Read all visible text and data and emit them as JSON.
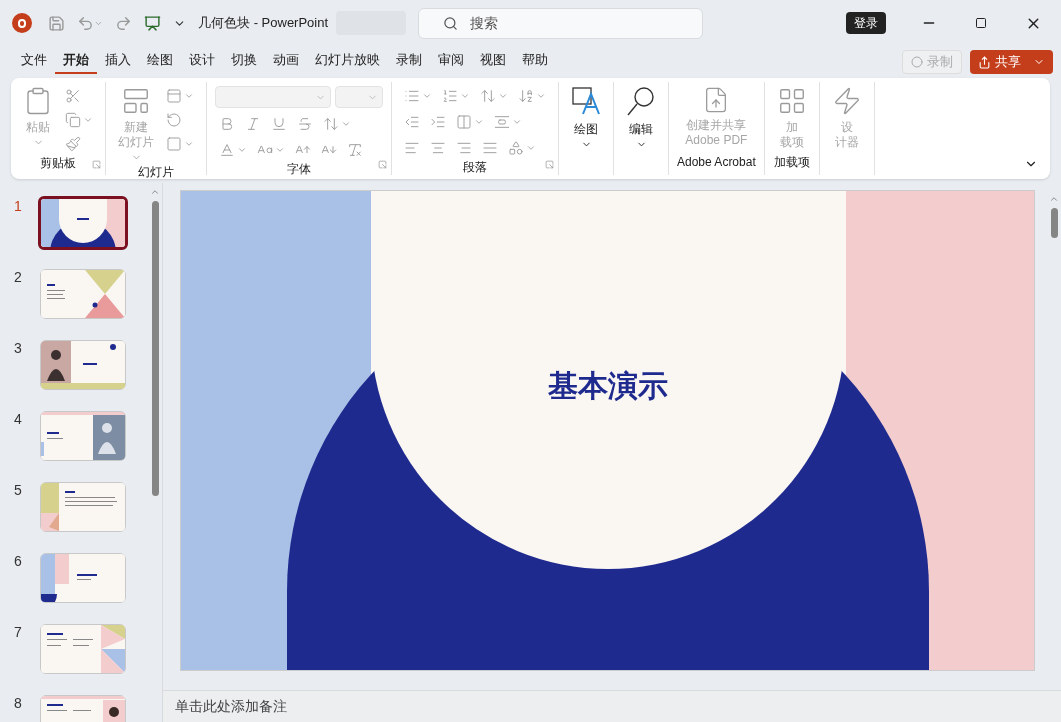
{
  "title_bar": {
    "doc_title": "几何色块",
    "separator": "-",
    "app_name": "PowerPoint",
    "search_placeholder": "搜索",
    "sign_in": "登录"
  },
  "menu_tabs": [
    {
      "label": "文件",
      "selected": false
    },
    {
      "label": "开始",
      "selected": true
    },
    {
      "label": "插入",
      "selected": false
    },
    {
      "label": "绘图",
      "selected": false
    },
    {
      "label": "设计",
      "selected": false
    },
    {
      "label": "切换",
      "selected": false
    },
    {
      "label": "动画",
      "selected": false
    },
    {
      "label": "幻灯片放映",
      "selected": false
    },
    {
      "label": "录制",
      "selected": false
    },
    {
      "label": "审阅",
      "selected": false
    },
    {
      "label": "视图",
      "selected": false
    },
    {
      "label": "帮助",
      "selected": false
    }
  ],
  "record_button": {
    "label": "录制",
    "disabled": true
  },
  "share_button": {
    "label": "共享"
  },
  "ribbon_groups": [
    {
      "kind": "clipboard",
      "label": "剪贴板",
      "launcher": true,
      "buttons": [
        {
          "lines": [
            "粘贴"
          ],
          "disabled": true,
          "dropdown": true
        }
      ]
    },
    {
      "kind": "slides",
      "label": "幻灯片",
      "buttons": [
        {
          "lines": [
            "新建",
            "幻灯片"
          ],
          "disabled": true,
          "dropdown": true
        }
      ]
    },
    {
      "kind": "font",
      "label": "字体",
      "launcher": true
    },
    {
      "kind": "paragraph",
      "label": "段落",
      "launcher": true
    },
    {
      "kind": "draw",
      "buttons": [
        {
          "lines": [
            "绘图"
          ],
          "disabled": false,
          "dropdown": true
        }
      ]
    },
    {
      "kind": "edit",
      "buttons": [
        {
          "lines": [
            "编辑"
          ],
          "disabled": false,
          "dropdown": true
        }
      ]
    },
    {
      "kind": "pdf",
      "label": "Adobe Acrobat",
      "buttons": [
        {
          "lines": [
            "创建并共享",
            "Adobe PDF"
          ],
          "disabled": true
        }
      ]
    },
    {
      "kind": "addins",
      "label": "加载项",
      "buttons": [
        {
          "lines": [
            "加",
            "载项"
          ],
          "disabled": true
        }
      ]
    },
    {
      "kind": "designer",
      "buttons": [
        {
          "lines": [
            "设",
            "计器"
          ],
          "disabled": true
        }
      ]
    }
  ],
  "slides": [
    {
      "number": "1",
      "selected": true,
      "kind": "title"
    },
    {
      "number": "2",
      "selected": false,
      "kind": "agenda"
    },
    {
      "number": "3",
      "selected": false,
      "kind": "photo-left"
    },
    {
      "number": "4",
      "selected": false,
      "kind": "photo-right"
    },
    {
      "number": "5",
      "selected": false,
      "kind": "bullets"
    },
    {
      "number": "6",
      "selected": false,
      "kind": "quarter"
    },
    {
      "number": "7",
      "selected": false,
      "kind": "columns"
    },
    {
      "number": "8",
      "selected": false,
      "kind": "photo-corner"
    }
  ],
  "current_slide": {
    "title": "基本演示"
  },
  "notes": {
    "placeholder": "单击此处添加备注"
  }
}
